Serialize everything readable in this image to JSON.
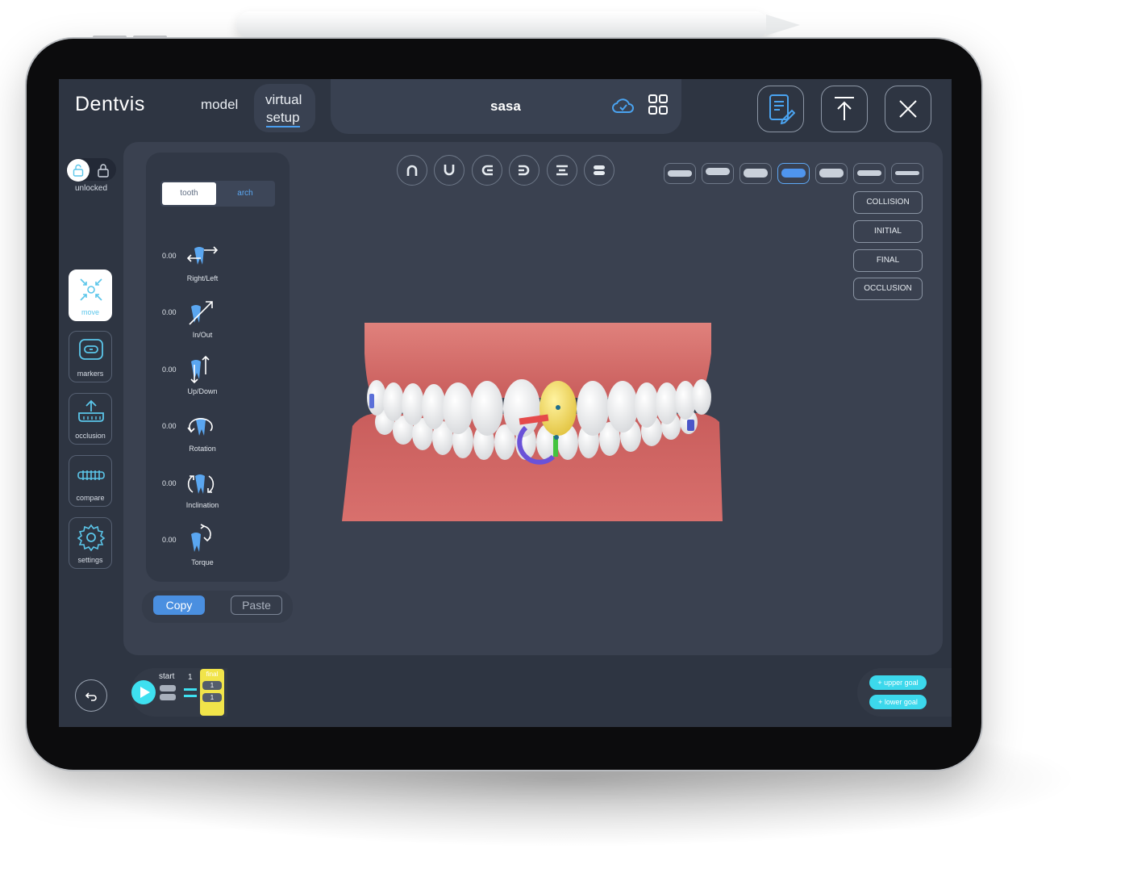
{
  "app": {
    "logo": "Dentvis",
    "nav": {
      "model": "model",
      "virtual_line1": "virtual",
      "virtual_line2": "setup"
    },
    "case_title": "sasa"
  },
  "header_icons": [
    "cloud-check-icon",
    "grid-icon",
    "report-edit-icon",
    "upload-icon",
    "close-icon"
  ],
  "lock": {
    "label": "unlocked",
    "state": "unlocked"
  },
  "tools": [
    {
      "label": "move",
      "icon": "move-icon",
      "active": true
    },
    {
      "label": "markers",
      "icon": "markers-icon",
      "active": false
    },
    {
      "label": "occlusion",
      "icon": "occlusion-icon",
      "active": false
    },
    {
      "label": "compare",
      "icon": "compare-icon",
      "active": false
    },
    {
      "label": "settings",
      "icon": "gear-icon",
      "active": false
    }
  ],
  "panel": {
    "segments": {
      "tooth": "tooth",
      "arch": "arch",
      "selected": "tooth"
    },
    "controls": [
      {
        "value": "0.00",
        "label": "Right/Left",
        "icon": "right-left-icon"
      },
      {
        "value": "0.00",
        "label": "In/Out",
        "icon": "in-out-icon"
      },
      {
        "value": "0.00",
        "label": "Up/Down",
        "icon": "up-down-icon"
      },
      {
        "value": "0.00",
        "label": "Rotation",
        "icon": "rotation-icon"
      },
      {
        "value": "0.00",
        "label": "Inclination",
        "icon": "inclination-icon"
      },
      {
        "value": "0.00",
        "label": "Torque",
        "icon": "torque-icon"
      }
    ],
    "copy": "Copy",
    "paste": "Paste"
  },
  "arch_view_icons": [
    "upper-arch-icon",
    "lower-arch-icon",
    "right-side-icon",
    "left-side-icon",
    "both-arches-icon",
    "front-icon"
  ],
  "view_buttons": {
    "count": 7,
    "active_index": 3
  },
  "side_buttons": [
    "COLLISION",
    "INITIAL",
    "FINAL",
    "OCCLUSION"
  ],
  "timeline": {
    "start": "start",
    "step": "1",
    "final": "final",
    "final_steps": [
      "1",
      "1"
    ]
  },
  "goals": {
    "upper": "+ upper goal",
    "lower": "+ lower goal"
  },
  "colors": {
    "screen_bg": "#2e3542",
    "accent_blue": "#4a8fe0",
    "accent_cyan": "#3ee0f0",
    "final_yellow": "#f1e44a",
    "gum": "#d26b6b"
  }
}
